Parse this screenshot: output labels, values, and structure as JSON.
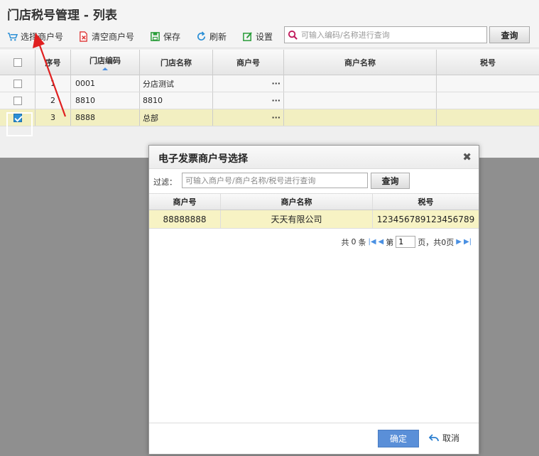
{
  "page": {
    "title": "门店税号管理 - 列表"
  },
  "toolbar": {
    "select_merchant": "选择商户号",
    "clear_merchant": "清空商户号",
    "save": "保存",
    "refresh": "刷新",
    "settings": "设置",
    "search_placeholder": "可输入编码/名称进行查询",
    "query": "查询"
  },
  "grid": {
    "columns": [
      "序号",
      "门店编码",
      "门店名称",
      "商户号",
      "商户名称",
      "税号"
    ],
    "rows": [
      {
        "no": "1",
        "code": "0001",
        "name": "分店测试",
        "merchant_no": "",
        "merchant_name": "",
        "tax_no": "",
        "checked": false
      },
      {
        "no": "2",
        "code": "8810",
        "name": "8810",
        "merchant_no": "",
        "merchant_name": "",
        "tax_no": "",
        "checked": false
      },
      {
        "no": "3",
        "code": "8888",
        "name": "总部",
        "merchant_no": "",
        "merchant_name": "",
        "tax_no": "",
        "checked": true
      }
    ],
    "ellipsis": "···"
  },
  "modal": {
    "title": "电子发票商户号选择",
    "filter_label": "过滤：",
    "filter_placeholder": "可输入商户号/商户名称/税号进行查询",
    "query": "查询",
    "columns": [
      "商户号",
      "商户名称",
      "税号"
    ],
    "rows": [
      {
        "merchant_no": "88888888",
        "merchant_name": "天天有限公司",
        "tax_no": "123456789123456789"
      }
    ],
    "pager": {
      "total_prefix": "共",
      "total_count": "0",
      "total_suffix": "条",
      "page_prefix": "第",
      "page_value": "1",
      "page_suffix": "页，共0页"
    },
    "ok": "确定",
    "cancel": "取消"
  },
  "colors": {
    "accent": "#4a90e2",
    "selected_row": "#f2efc1",
    "annotation_arrow": "#e02020"
  }
}
